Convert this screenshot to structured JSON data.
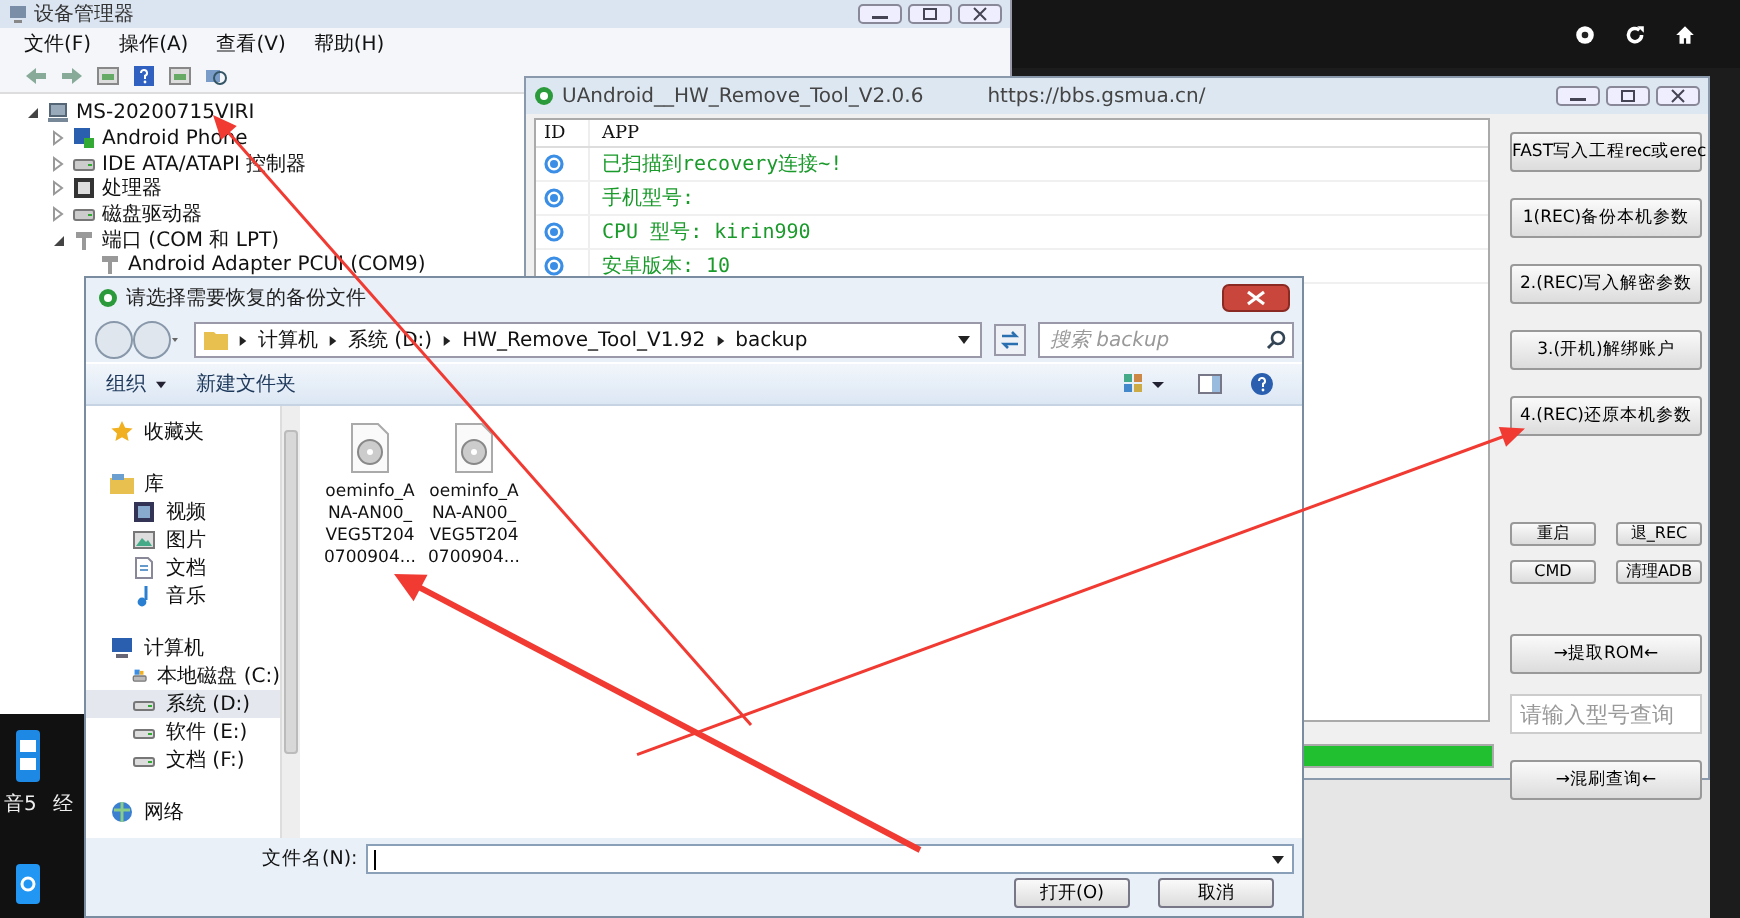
{
  "device_manager": {
    "title": "设备管理器",
    "menu": [
      "文件(F)",
      "操作(A)",
      "查看(V)",
      "帮助(H)"
    ],
    "tree": [
      {
        "label": "MS-20200715VIRI",
        "expanded": true,
        "children": [
          {
            "label": "Android Phone",
            "expanded": false,
            "kind": "phone"
          },
          {
            "label": "IDE ATA/ATAPI 控制器",
            "expanded": false,
            "kind": "disk"
          },
          {
            "label": "处理器",
            "expanded": false,
            "kind": "chip"
          },
          {
            "label": "磁盘驱动器",
            "expanded": false,
            "kind": "disk"
          },
          {
            "label": "端口 (COM 和 LPT)",
            "expanded": true,
            "kind": "port",
            "children": [
              {
                "label": "Android Adapter PCUI (COM9)"
              }
            ]
          }
        ]
      }
    ]
  },
  "tool": {
    "title": "UAndroid__HW_Remove_Tool_V2.0.6",
    "url": "https://bbs.gsmua.cn/",
    "columns": [
      "ID",
      "APP"
    ],
    "rows": [
      "已扫描到recovery连接~!",
      "手机型号:",
      "CPU 型号: kirin990",
      "安卓版本: 10"
    ],
    "buttons": [
      "FAST写入工程rec或erec",
      "1(REC)备份本机参数",
      "2.(REC)写入解密参数",
      "3.(开机)解绑账户",
      "4.(REC)还原本机参数"
    ],
    "small_buttons": [
      "重启",
      "退_REC",
      "CMD",
      "清理ADB"
    ],
    "rom_button": "→提取ROM←",
    "model_search": {
      "placeholder": "请输入型号查询"
    },
    "query_button": "→混刷查询←",
    "progress": {
      "level": 1
    }
  },
  "dialog": {
    "title": "请选择需要恢复的备份文件",
    "path": [
      "计算机",
      "系统 (D:)",
      "HW_Remove_Tool_V1.92",
      "backup"
    ],
    "search": {
      "placeholder": "搜索 backup"
    },
    "toolbar": [
      {
        "label": "组织",
        "dropdown": true
      },
      {
        "label": "新建文件夹",
        "dropdown": false
      }
    ],
    "nav": [
      {
        "label": "收藏夹",
        "kind": "star",
        "selected": false
      },
      {
        "label": "库",
        "kind": "library",
        "selected": false,
        "children": [
          {
            "label": "视频",
            "kind": "video",
            "selected": false
          },
          {
            "label": "图片",
            "kind": "picture",
            "selected": false
          },
          {
            "label": "文档",
            "kind": "document",
            "selected": false
          },
          {
            "label": "音乐",
            "kind": "music",
            "selected": false
          }
        ]
      },
      {
        "label": "计算机",
        "kind": "computer",
        "selected": false,
        "children": [
          {
            "label": "本地磁盘 (C:)",
            "kind": "system-drive",
            "selected": false
          },
          {
            "label": "系统 (D:)",
            "kind": "drive",
            "selected": true
          },
          {
            "label": "软件 (E:)",
            "kind": "drive",
            "selected": false
          },
          {
            "label": "文档 (F:)",
            "kind": "drive",
            "selected": false
          }
        ]
      },
      {
        "label": "网络",
        "kind": "network",
        "selected": false
      }
    ],
    "files": [
      {
        "name": "oeminfo_ANA-AN00_VEG5T2040700904..."
      },
      {
        "name": "oeminfo_ANA-AN00_VEG5T2040700904..."
      }
    ],
    "filename_label": "文件名(N):",
    "buttons": [
      "打开(O)",
      "取消"
    ]
  },
  "desktop": {
    "labels": [
      "音5",
      "经"
    ]
  }
}
